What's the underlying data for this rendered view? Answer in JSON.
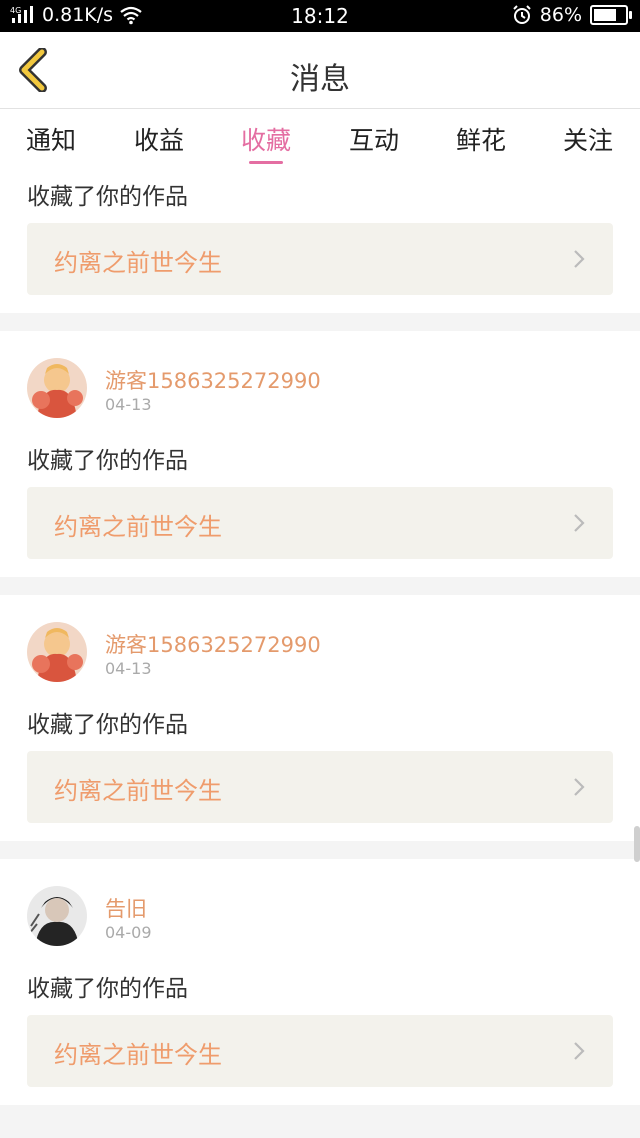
{
  "status_bar": {
    "network": "4G",
    "speed": "0.81K/s",
    "time": "18:12",
    "battery": "86%",
    "battery_level": 0.86
  },
  "header": {
    "title": "消息",
    "back_icon": "chevron-left-icon"
  },
  "tabs": [
    {
      "label": "通知"
    },
    {
      "label": "收益"
    },
    {
      "label": "收藏"
    },
    {
      "label": "互动"
    },
    {
      "label": "鲜花"
    },
    {
      "label": "关注"
    }
  ],
  "active_tab": "收藏",
  "items": [
    {
      "action": "收藏了你的作品",
      "work": "约离之前世今生"
    },
    {
      "user": "游客1586325272990",
      "date": "04-13",
      "action": "收藏了你的作品",
      "work": "约离之前世今生"
    },
    {
      "user": "游客1586325272990",
      "date": "04-13",
      "action": "收藏了你的作品",
      "work": "约离之前世今生"
    },
    {
      "user": "告旧",
      "date": "04-09",
      "action": "收藏了你的作品",
      "work": "约离之前世今生"
    }
  ],
  "colors": {
    "accent": "#e46ea2",
    "username": "#e49a6c",
    "work_title": "#ef9c6c",
    "back_icon": "#f2c83e"
  }
}
